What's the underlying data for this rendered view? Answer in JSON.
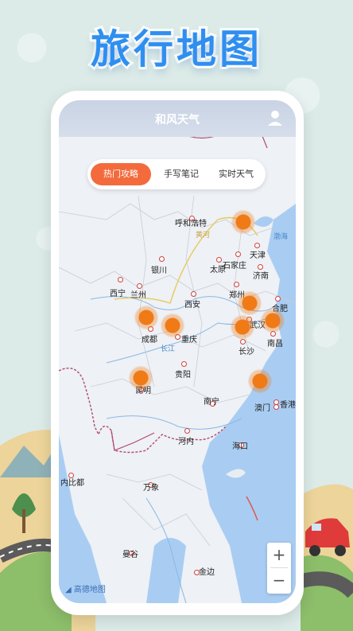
{
  "promo": {
    "title": "旅行地图"
  },
  "app": {
    "title": "和风天气",
    "user_icon": "user-icon"
  },
  "tabs": [
    {
      "label": "热门攻略",
      "active": true
    },
    {
      "label": "手写笔记",
      "active": false
    },
    {
      "label": "实时天气",
      "active": false
    }
  ],
  "map": {
    "cities": [
      {
        "id": "hohhot",
        "label": "呼和浩特"
      },
      {
        "id": "tianjin",
        "label": "天津"
      },
      {
        "id": "yinchuan",
        "label": "银川"
      },
      {
        "id": "taiyuan",
        "label": "太原"
      },
      {
        "id": "shijiazhuang",
        "label": "石家庄"
      },
      {
        "id": "jinan",
        "label": "济南"
      },
      {
        "id": "xining",
        "label": "西宁"
      },
      {
        "id": "lanzhou",
        "label": "兰州"
      },
      {
        "id": "zhengzhou",
        "label": "郑州"
      },
      {
        "id": "xian",
        "label": "西安"
      },
      {
        "id": "hefei",
        "label": "合肥"
      },
      {
        "id": "wuhan",
        "label": "武汉"
      },
      {
        "id": "chengdu",
        "label": "成都"
      },
      {
        "id": "chongqing",
        "label": "重庆"
      },
      {
        "id": "changsha",
        "label": "长沙"
      },
      {
        "id": "nanchang",
        "label": "南昌"
      },
      {
        "id": "guiyang",
        "label": "贵阳"
      },
      {
        "id": "kunming",
        "label": "昆明"
      },
      {
        "id": "nanning",
        "label": "南宁"
      },
      {
        "id": "macau",
        "label": "澳门"
      },
      {
        "id": "hongkong",
        "label": "香港"
      },
      {
        "id": "hanoi",
        "label": "河内"
      },
      {
        "id": "haikou",
        "label": "海口"
      },
      {
        "id": "naypyidaw",
        "label": "内比都"
      },
      {
        "id": "vientiane",
        "label": "万象"
      },
      {
        "id": "bangkok",
        "label": "曼谷"
      },
      {
        "id": "phnompenh",
        "label": "金边"
      }
    ],
    "water_labels": {
      "bohai": "渤海",
      "huanghe": "黄河",
      "changjiang": "长江"
    },
    "attribution": "高德地图",
    "zoom_in": "+",
    "zoom_out": "−"
  }
}
